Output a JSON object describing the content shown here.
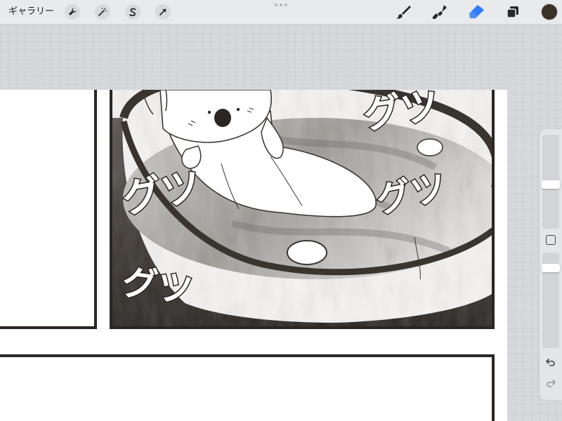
{
  "toolbar": {
    "gallery_label": "ギャラリー",
    "left_tools": [
      "wrench-icon",
      "magic-wand-icon",
      "selection-icon",
      "transform-arrow-icon"
    ],
    "right_tools": [
      "brush-icon",
      "smudge-icon",
      "eraser-icon",
      "layers-icon"
    ],
    "active_tool": "eraser-icon",
    "active_color": "#3a3128",
    "accent": "#2f7df6"
  },
  "canvas": {
    "sfx_1": "グツ",
    "sfx_2": "グツ",
    "sfx_3": "グツ",
    "sfx_4": "グツ"
  },
  "sidebar": {
    "brush_size": 0.47,
    "opacity": 0.87
  }
}
